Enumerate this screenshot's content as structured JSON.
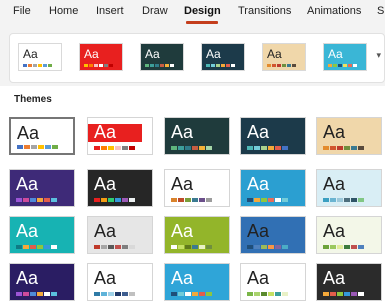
{
  "menubar": {
    "tabs": [
      "File",
      "Home",
      "Insert",
      "Draw",
      "Design",
      "Transitions",
      "Animations",
      "S"
    ],
    "active": "Design",
    "accent_color": "#c43e1c"
  },
  "ribbon": {
    "theme_strip": [
      {
        "label": "Aa",
        "bg": "#ffffff",
        "fg": "#222222",
        "dots": [
          "#4472c4",
          "#ed7d31",
          "#a5a5a5",
          "#ffc000",
          "#5b9bd5",
          "#70ad47"
        ]
      },
      {
        "label": "Aa",
        "bg": "#e8201f",
        "fg": "#ffffff",
        "dots": [
          "#ffc000",
          "#ff7f00",
          "#f8c2c2",
          "#ffffff",
          "#7f7f7f",
          "#c00000"
        ]
      },
      {
        "label": "Aa",
        "bg": "#1f3b3c",
        "fg": "#ffffff",
        "dots": [
          "#5fb67d",
          "#3d9f9b",
          "#2f7c8a",
          "#c75d42",
          "#f2b138",
          "#ffffff"
        ]
      },
      {
        "label": "Aa",
        "bg": "#1c3a4a",
        "fg": "#ffffff",
        "dots": [
          "#4db7b5",
          "#73ccd9",
          "#a8d08d",
          "#f4a93a",
          "#e35d4b",
          "#ffffff"
        ]
      },
      {
        "label": "Aa",
        "bg": "#f0d7aa",
        "fg": "#222222",
        "dots": [
          "#e38b2d",
          "#d1552e",
          "#bd3b2e",
          "#6f8f3e",
          "#3b7a91",
          "#594a3c"
        ]
      },
      {
        "label": "Aa",
        "bg": "#3ab6d6",
        "fg": "#ffffff",
        "dots": [
          "#f4a93a",
          "#8ec63f",
          "#1f4e79",
          "#f0e05d",
          "#e66c5a",
          "#ffffff"
        ]
      }
    ],
    "more_icon": "chevron-down"
  },
  "gallery": {
    "title": "Themes",
    "rows": [
      [
        {
          "label": "Aa",
          "bg": "#ffffff",
          "fg": "#222222",
          "swatches": [
            "#4472c4",
            "#ed7d31",
            "#a5a5a5",
            "#ffc000",
            "#5b9bd5",
            "#70ad47"
          ],
          "selected": true
        },
        {
          "label": "Aa",
          "bg": "#ffffff",
          "fg": "#ffffff",
          "accent": "#e8201f",
          "swatches": [
            "#e8201f",
            "#ff7f00",
            "#ffc000",
            "#f8c2c2",
            "#7f7f7f",
            "#c00000"
          ]
        },
        {
          "label": "Aa",
          "bg": "#1f3b3c",
          "fg": "#ffffff",
          "swatches": [
            "#5fb67d",
            "#3d9f9b",
            "#2f7c8a",
            "#c75d42",
            "#f2b138",
            "#a5d6a7"
          ]
        },
        {
          "label": "Aa",
          "bg": "#1c3a4a",
          "fg": "#ffffff",
          "swatches": [
            "#4db7b5",
            "#73ccd9",
            "#a8d08d",
            "#f4a93a",
            "#e35d4b",
            "#4472c4"
          ]
        },
        {
          "label": "Aa",
          "bg": "#f0d7aa",
          "fg": "#222222",
          "swatches": [
            "#e38b2d",
            "#d1552e",
            "#bd3b2e",
            "#6f8f3e",
            "#3b7a91",
            "#594a3c"
          ]
        }
      ],
      [
        {
          "label": "Aa",
          "bg": "#3e2a78",
          "fg": "#ffffff",
          "swatches": [
            "#9c55d6",
            "#ce4b9b",
            "#4f8ad9",
            "#f4a93a",
            "#e35d4b",
            "#5bc0de"
          ]
        },
        {
          "label": "Aa",
          "bg": "#262626",
          "fg": "#ffffff",
          "swatches": [
            "#e8201f",
            "#f39c12",
            "#2ecc71",
            "#3498db",
            "#9b59b6",
            "#ecf0f1"
          ]
        },
        {
          "label": "Aa",
          "bg": "#ffffff",
          "fg": "#222222",
          "swatches": [
            "#d9822b",
            "#bf4b2a",
            "#7a9e3b",
            "#3b7a91",
            "#6b4f8a",
            "#9c9c9c"
          ]
        },
        {
          "label": "Aa",
          "bg": "#2b9fd1",
          "fg": "#ffffff",
          "swatches": [
            "#1f4e79",
            "#f4a93a",
            "#8ec63f",
            "#e66c5a",
            "#ffffff",
            "#73ccd9"
          ]
        },
        {
          "label": "Aa",
          "bg": "#d9eef5",
          "fg": "#222222",
          "swatches": [
            "#3b9fc1",
            "#6bb4d1",
            "#9cc8da",
            "#4d6e7d",
            "#2f5467",
            "#81c784"
          ]
        }
      ],
      [
        {
          "label": "Aa",
          "bg": "#17b3b3",
          "fg": "#ffffff",
          "swatches": [
            "#0f7b85",
            "#f4a93a",
            "#e35d4b",
            "#8ec63f",
            "#3498db",
            "#ffffff"
          ]
        },
        {
          "label": "Aa",
          "bg": "#e6e6e6",
          "fg": "#222222",
          "swatches": [
            "#bf3a2b",
            "#a5a5a5",
            "#595959",
            "#c0504d",
            "#7f7f7f",
            "#d9d9d9"
          ]
        },
        {
          "label": "Aa",
          "bg": "#93b52a",
          "fg": "#ffffff",
          "swatches": [
            "#ffffff",
            "#c5e063",
            "#5f7a1b",
            "#3b7a91",
            "#e9f1c6",
            "#6f8f3e"
          ]
        },
        {
          "label": "Aa",
          "bg": "#3170b4",
          "fg": "#222222",
          "swatches": [
            "#1f4e79",
            "#4f81bd",
            "#9bbb59",
            "#f79646",
            "#8064a2",
            "#4bacc6"
          ]
        },
        {
          "label": "Aa",
          "bg": "#f3f7e8",
          "fg": "#222222",
          "swatches": [
            "#6ca33a",
            "#9bc85e",
            "#e2ec9c",
            "#3c7a3c",
            "#c0504d",
            "#4f81bd"
          ]
        }
      ],
      [
        {
          "label": "Aa",
          "bg": "#2a1d63",
          "fg": "#ffffff",
          "swatches": [
            "#9c55d6",
            "#ce4b9b",
            "#4f8ad9",
            "#f4a93a",
            "#ffffff",
            "#5bc0de"
          ]
        },
        {
          "label": "Aa",
          "bg": "#ffffff",
          "fg": "#222222",
          "swatches": [
            "#2f7ba6",
            "#5fb3d9",
            "#9ed1e8",
            "#213a6b",
            "#3e5d8f",
            "#c0c0c0"
          ]
        },
        {
          "label": "Aa",
          "bg": "#2fa5d8",
          "fg": "#ffffff",
          "swatches": [
            "#1f4e79",
            "#73ccd9",
            "#ffffff",
            "#f4a93a",
            "#e35d4b",
            "#8ec63f"
          ]
        },
        {
          "label": "Aa",
          "bg": "#ffffff",
          "fg": "#222222",
          "swatches": [
            "#7ab648",
            "#a9d36d",
            "#5a8a2d",
            "#c5e063",
            "#3d9f9b",
            "#e9f1c6"
          ]
        },
        {
          "label": "Aa",
          "bg": "#2b2b2b",
          "fg": "#ffffff",
          "swatches": [
            "#f4a93a",
            "#e35d4b",
            "#8ec63f",
            "#3498db",
            "#9b59b6",
            "#ffffff"
          ]
        }
      ]
    ]
  }
}
